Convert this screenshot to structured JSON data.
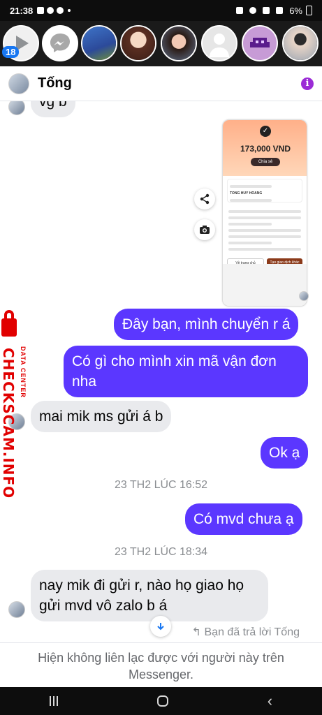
{
  "status_bar": {
    "time": "21:38",
    "battery": "6%"
  },
  "chat_heads": {
    "unread_count": "18"
  },
  "header": {
    "contact_name": "Tống"
  },
  "messages": {
    "partial_in": "vg b",
    "out_1": "Đây bạn, mình chuyển r á",
    "out_2": "Có gì cho mình xin mã vận đơn nha",
    "in_1": "mai mik ms gửi á b",
    "out_3": "Ok ạ",
    "ts_1": "23 TH2 LÚC 16:52",
    "out_4": "Có mvd chưa ạ",
    "ts_2": "23 TH2 LÚC 18:34",
    "in_2": "nay mik đi gửi r, nào họ giao họ gửi mvd vô zalo b á"
  },
  "receipt": {
    "amount": "173,000 VND",
    "button": "Chia sẻ",
    "recipient": "TONG HUY HOANG",
    "btn_left": "Về trang chủ",
    "btn_right": "Tạo giao dịch khác"
  },
  "reply_note": "Bạn đã trả lời Tống",
  "footer_notice": "Hiện không liên lạc được với người này trên Messenger.",
  "watermark": {
    "main": "CHECKSCAM.INFO",
    "sub": "DATA CENTER"
  }
}
